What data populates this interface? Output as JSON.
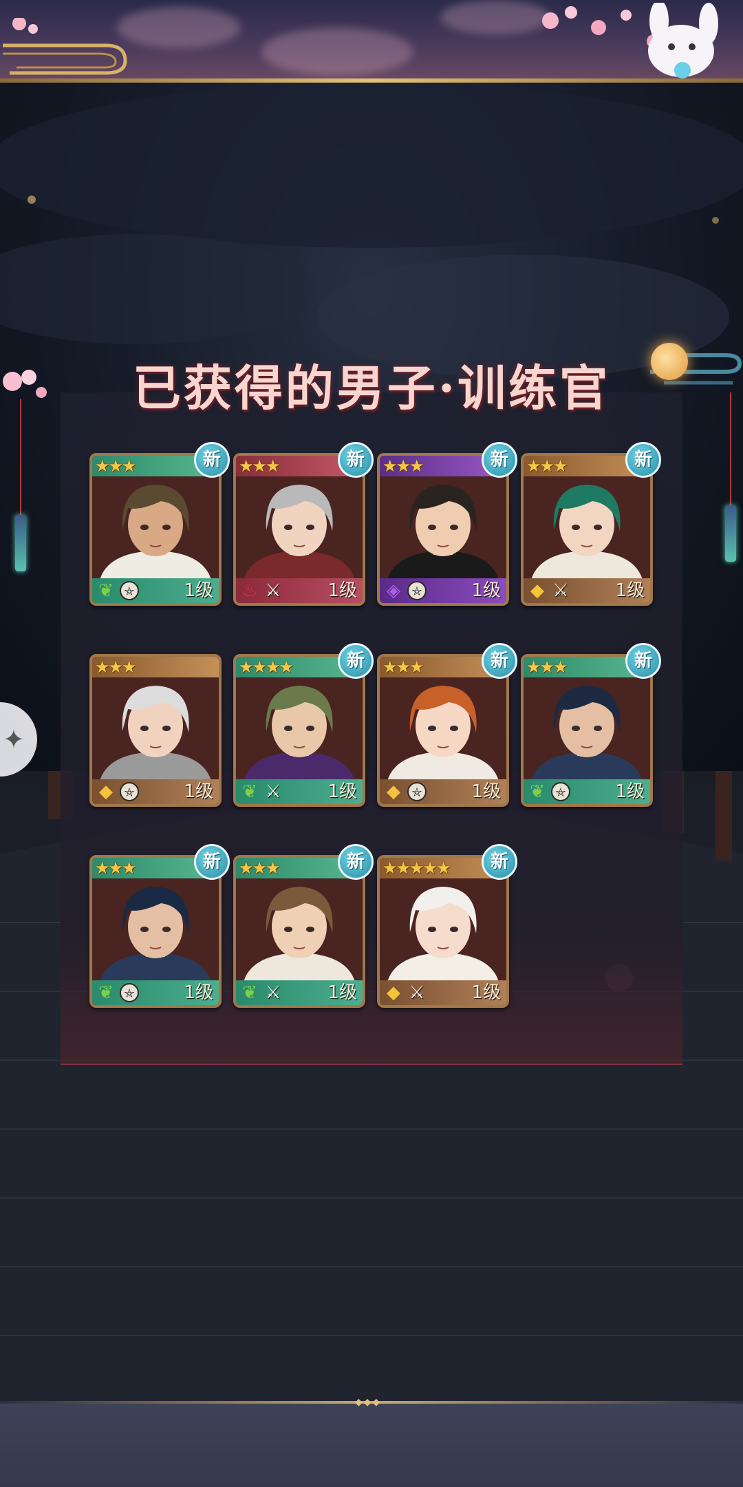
{
  "panel": {
    "title": "已获得的男子·训练官"
  },
  "new_label": "新",
  "cards": [
    {
      "stars": "★★★",
      "theme": "green",
      "element": "leaf",
      "weapon": "pentacle",
      "level": "1级",
      "hair": "#5a4a32",
      "skin": "#d9a884",
      "outfit": "#efece4",
      "new": true
    },
    {
      "stars": "★★★",
      "theme": "red",
      "element": "fire",
      "weapon": "swords",
      "level": "1级",
      "hair": "#b9b9b9",
      "skin": "#f0d4c0",
      "outfit": "#7a2a2a",
      "new": true
    },
    {
      "stars": "★★★",
      "theme": "purple",
      "element": "crystal",
      "weapon": "pentacle",
      "level": "1级",
      "hair": "#2a2420",
      "skin": "#f0cdb0",
      "outfit": "#1a1a1a",
      "new": true
    },
    {
      "stars": "★★★",
      "theme": "brown",
      "element": "diamond",
      "weapon": "swords",
      "level": "1级",
      "hair": "#1e7a62",
      "skin": "#f2d6c2",
      "outfit": "#eee8dc",
      "new": true
    },
    {
      "stars": "★★★",
      "theme": "brown",
      "element": "diamond",
      "weapon": "pentacle",
      "level": "1级",
      "hair": "#dcdcdc",
      "skin": "#f0d2be",
      "outfit": "#9a9a9a",
      "new": false
    },
    {
      "stars": "★★★★",
      "theme": "green",
      "element": "leaf",
      "weapon": "swords",
      "level": "1级",
      "hair": "#6a7a4a",
      "skin": "#e8c8a8",
      "outfit": "#4a2a6a",
      "new": true
    },
    {
      "stars": "★★★",
      "theme": "brown",
      "element": "diamond",
      "weapon": "pentacle",
      "level": "1级",
      "hair": "#c8602a",
      "skin": "#f6d8c4",
      "outfit": "#efeae2",
      "new": true
    },
    {
      "stars": "★★★",
      "theme": "green",
      "element": "leaf",
      "weapon": "pentacle",
      "level": "1级",
      "hair": "#1e2a42",
      "skin": "#e4bfa4",
      "outfit": "#2a3a5a",
      "new": true
    },
    {
      "stars": "★★★",
      "theme": "green",
      "element": "leaf",
      "weapon": "pentacle",
      "level": "1级",
      "hair": "#1a2a44",
      "skin": "#e4bfa4",
      "outfit": "#2a3a5a",
      "new": true
    },
    {
      "stars": "★★★",
      "theme": "green",
      "element": "leaf",
      "weapon": "swords",
      "level": "1级",
      "hair": "#7a5a3a",
      "skin": "#f0d0b4",
      "outfit": "#eee8dc",
      "new": true
    },
    {
      "stars": "★★★★★",
      "theme": "brown",
      "element": "diamond",
      "weapon": "swords",
      "level": "1级",
      "hair": "#f2f0ec",
      "skin": "#f6dccc",
      "outfit": "#f4efe6",
      "new": true
    }
  ]
}
